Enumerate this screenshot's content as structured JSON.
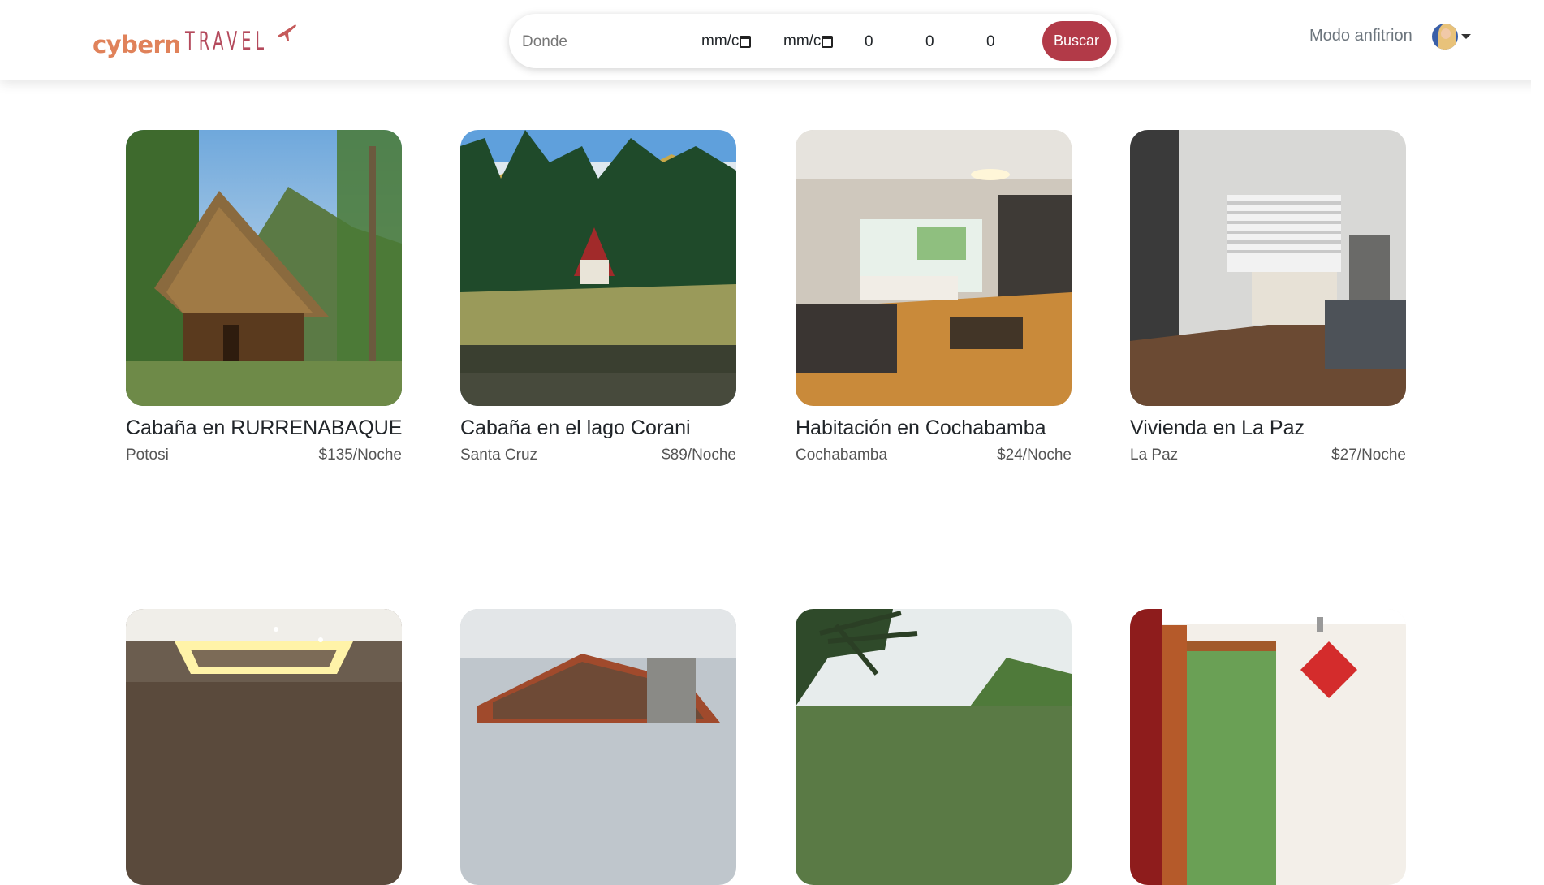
{
  "brand": {
    "left": "cybern",
    "right": "TRAVEL"
  },
  "search": {
    "where_placeholder": "Donde",
    "checkin": "mm/c",
    "checkout": "mm/c",
    "adults": "0",
    "children": "0",
    "pets": "0",
    "button_label": "Buscar"
  },
  "nav": {
    "host_mode": "Modo anfitrion"
  },
  "colors": {
    "accent": "#b23a48",
    "logo_left": "#e0825a",
    "logo_right": "#b44a5c"
  },
  "listings": [
    {
      "title": "Cabaña en RURRENABAQUE",
      "location": "Potosi",
      "price": "$135/Noche"
    },
    {
      "title": "Cabaña en el lago Corani",
      "location": "Santa Cruz",
      "price": "$89/Noche"
    },
    {
      "title": "Habitación en Cochabamba",
      "location": "Cochabamba",
      "price": "$24/Noche"
    },
    {
      "title": "Vivienda en La Paz",
      "location": "La Paz",
      "price": "$27/Noche"
    }
  ]
}
